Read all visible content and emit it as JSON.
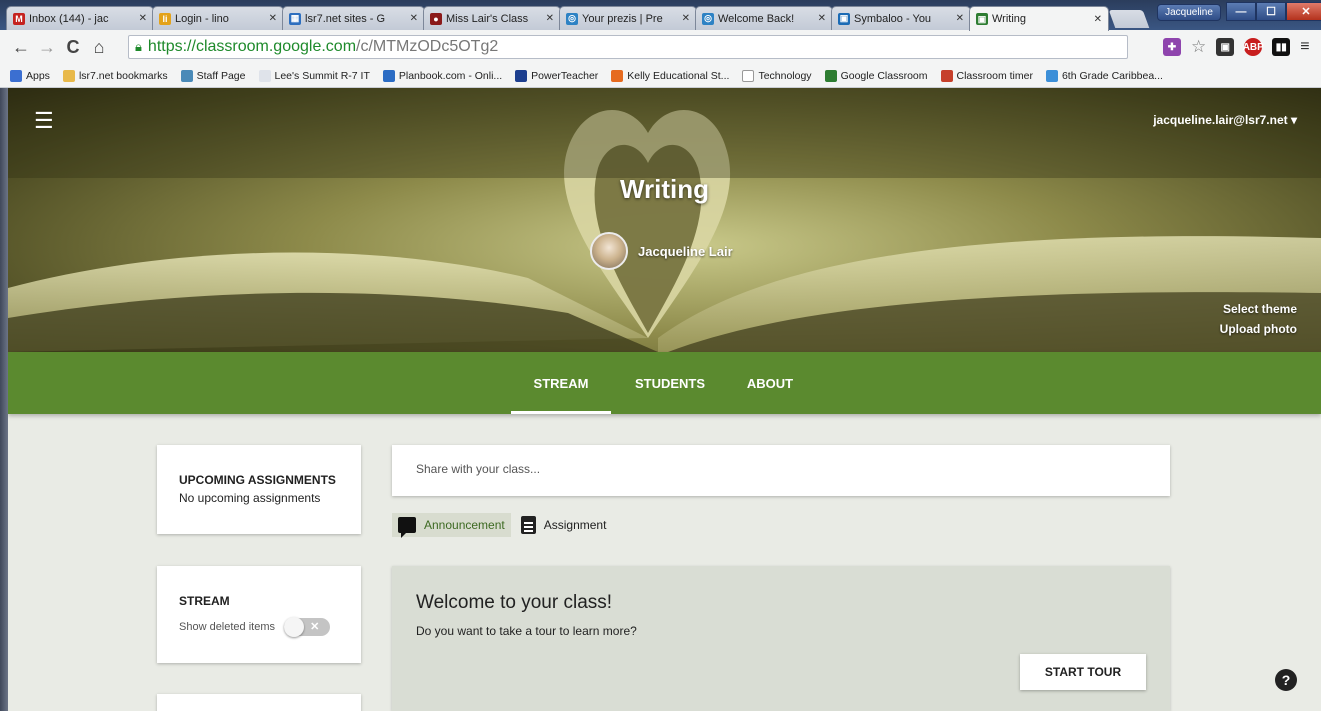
{
  "browser": {
    "tabs": [
      {
        "label": "Inbox (144) - jac",
        "fav": "M",
        "fav_color": "#c5221f"
      },
      {
        "label": "Login - lino",
        "fav": "li",
        "fav_color": "#e3a21a"
      },
      {
        "label": "lsr7.net sites - G",
        "fav": "▦",
        "fav_color": "#2e6fbf"
      },
      {
        "label": "Miss Lair's Class",
        "fav": "●",
        "fav_color": "#8b1a1a"
      },
      {
        "label": "Your prezis | Pre",
        "fav": "◎",
        "fav_color": "#2d82c4"
      },
      {
        "label": "Welcome Back!",
        "fav": "◎",
        "fav_color": "#2d82c4"
      },
      {
        "label": "Symbaloo - You",
        "fav": "▣",
        "fav_color": "#1b6bb5"
      },
      {
        "label": "Writing",
        "fav": "▣",
        "fav_color": "#2e7d32",
        "active": true
      }
    ],
    "profile_name": "Jacqueline",
    "url_host": "https://classroom.google.com",
    "url_path": "/c/MTMzODc5OTg2",
    "bookmarks": [
      {
        "label": "Apps",
        "color": "#3b6fd1"
      },
      {
        "label": "lsr7.net bookmarks",
        "color": "#e8b94a"
      },
      {
        "label": "Staff Page",
        "color": "#4a8ab8"
      },
      {
        "label": "Lee's Summit R-7 IT",
        "color": "#dfe3ea"
      },
      {
        "label": "Planbook.com - Onli...",
        "color": "#2b6cc4"
      },
      {
        "label": "PowerTeacher",
        "color": "#1d3f8f"
      },
      {
        "label": "Kelly Educational St...",
        "color": "#e66b1f"
      },
      {
        "label": "Technology",
        "color": "#ffffff"
      },
      {
        "label": "Google Classroom",
        "color": "#2e7d32"
      },
      {
        "label": "Classroom timer",
        "color": "#c6402b"
      },
      {
        "label": "6th Grade Caribbea...",
        "color": "#3c8fd8"
      }
    ]
  },
  "classroom": {
    "user_email": "jacqueline.lair@lsr7.net",
    "class_name": "Writing",
    "teacher_name": "Jacqueline Lair",
    "select_theme": "Select theme",
    "upload_photo": "Upload photo",
    "tabs": [
      "STREAM",
      "STUDENTS",
      "ABOUT"
    ],
    "upcoming": {
      "title": "UPCOMING ASSIGNMENTS",
      "text": "No upcoming assignments"
    },
    "stream_card": {
      "title": "STREAM",
      "toggle_label": "Show deleted items"
    },
    "share_placeholder": "Share with your class...",
    "post_types": [
      "Announcement",
      "Assignment"
    ],
    "welcome": {
      "title": "Welcome to your class!",
      "text": "Do you want to take a tour to learn more?",
      "button": "START TOUR"
    },
    "help_label": "?"
  },
  "colors": {
    "accent_green": "#5b8a2f",
    "page_bg": "#e9ebe5"
  }
}
